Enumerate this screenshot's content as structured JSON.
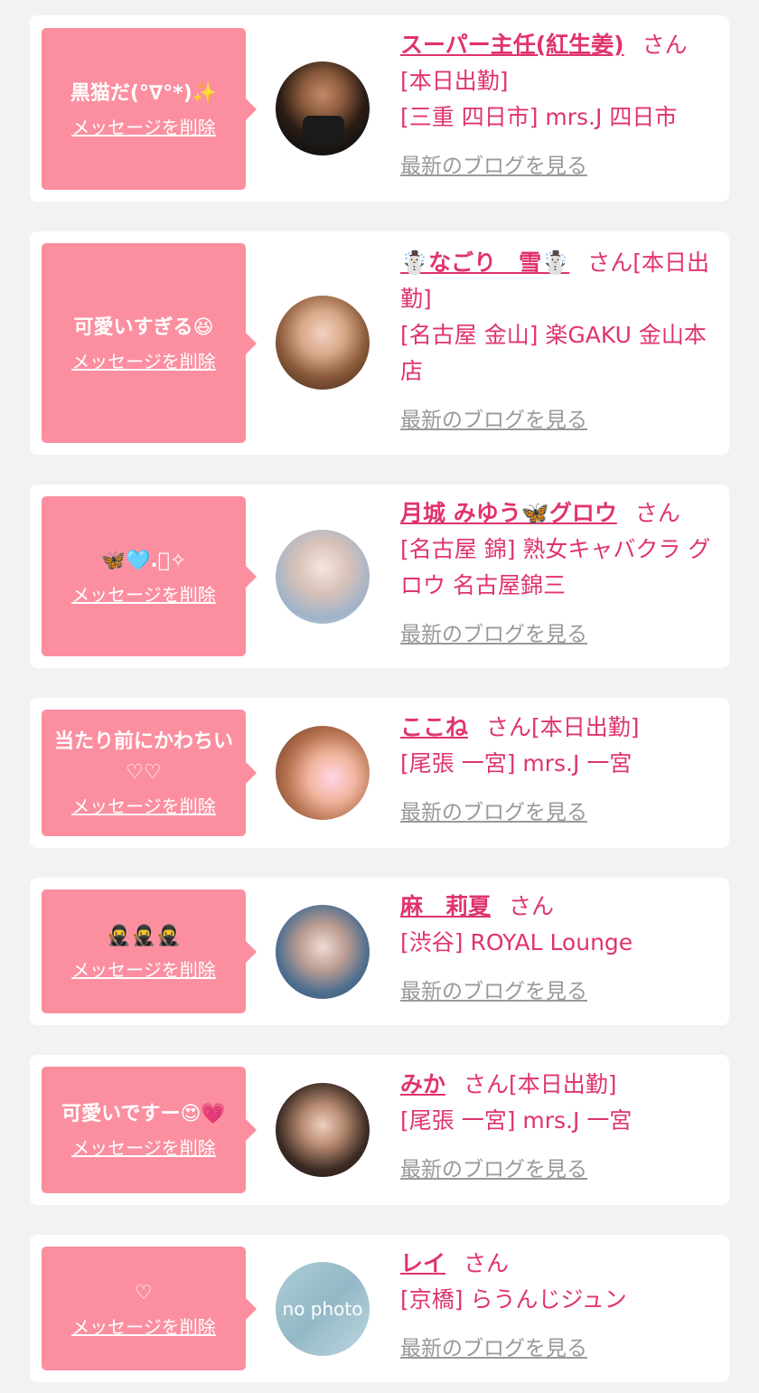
{
  "delete_label": "メッセージを削除",
  "blog_label": "最新のブログを見る",
  "san_label": "さん",
  "accent_color": "#e0346b",
  "bubble_color": "#fb8fa0",
  "entries": [
    {
      "message": "黒猫だ(°∇°*)✨",
      "name": "スーパー主任(紅生姜)",
      "status": "[本日出勤]",
      "shop": "[三重 四日市] mrs.J 四日市"
    },
    {
      "message": "可愛いすぎる😆",
      "name": "☃️なごり　雪☃️",
      "status": "[本日出勤]",
      "shop": "[名古屋 金山] 楽GAKU 金山本店"
    },
    {
      "message": "🦋🩵.ﾟ✧",
      "name": "月城 みゆう🦋グロウ",
      "status": "",
      "shop": "[名古屋 錦] 熟女キャバクラ グロウ 名古屋錦三"
    },
    {
      "message": "当たり前にかわちい♡♡",
      "name": "ここね",
      "status": "[本日出勤]",
      "shop": "[尾張 一宮] mrs.J 一宮"
    },
    {
      "message": "🥷🥷🥷",
      "name": "麻　莉夏",
      "status": "",
      "shop": "[渋谷] ROYAL Lounge"
    },
    {
      "message": "可愛いですー😍💗",
      "name": "みか",
      "status": "[本日出勤]",
      "shop": "[尾張 一宮] mrs.J 一宮"
    },
    {
      "message": "♡",
      "name": "レイ",
      "status": "",
      "shop": "[京橋] らうんじジュン",
      "avatar_text": "no photo"
    }
  ]
}
